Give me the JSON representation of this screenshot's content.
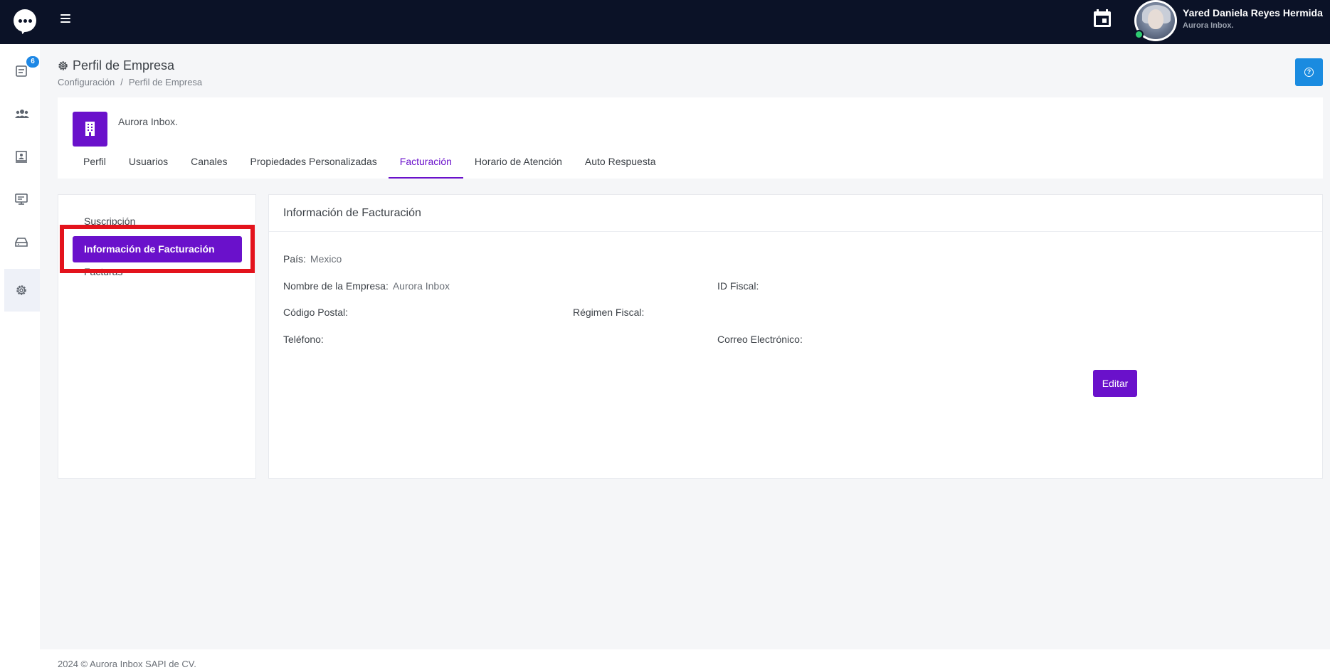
{
  "header": {
    "user_name": "Yared Daniela Reyes Hermida",
    "user_org": "Aurora Inbox."
  },
  "sidebar": {
    "badge_count": "6",
    "items": [
      {
        "icon": "inbox-icon"
      },
      {
        "icon": "users-icon"
      },
      {
        "icon": "contact-card-icon"
      },
      {
        "icon": "monitor-icon"
      },
      {
        "icon": "tray-icon"
      },
      {
        "icon": "gear-icon"
      }
    ]
  },
  "page": {
    "title": "Perfil de Empresa",
    "breadcrumb": [
      "Configuración",
      "/",
      "Perfil de Empresa"
    ]
  },
  "company": {
    "name": "Aurora Inbox.",
    "tabs": [
      "Perfil",
      "Usuarios",
      "Canales",
      "Propiedades Personalizadas",
      "Facturación",
      "Horario de Atención",
      "Auto Respuesta"
    ],
    "active_tab": "Facturación"
  },
  "billing_menu": {
    "items": [
      "Suscripción",
      "Información de Facturación",
      "Facturas"
    ],
    "active": "Información de Facturación"
  },
  "billing_info": {
    "title": "Información de Facturación",
    "country_label": "País:",
    "country_value": "Mexico",
    "company_label": "Nombre de la Empresa:",
    "company_value": "Aurora Inbox",
    "tax_id_label": "ID Fiscal:",
    "postal_label": "Código Postal:",
    "regime_label": "Régimen Fiscal:",
    "phone_label": "Teléfono:",
    "email_label": "Correo Electrónico:",
    "edit_label": "Editar"
  },
  "footer": {
    "text": "2024 © Aurora Inbox SAPI de CV."
  },
  "colors": {
    "topbar": "#0b1227",
    "accent": "#6a11cb",
    "help": "#1a8be0",
    "highlight": "#e3131c"
  }
}
